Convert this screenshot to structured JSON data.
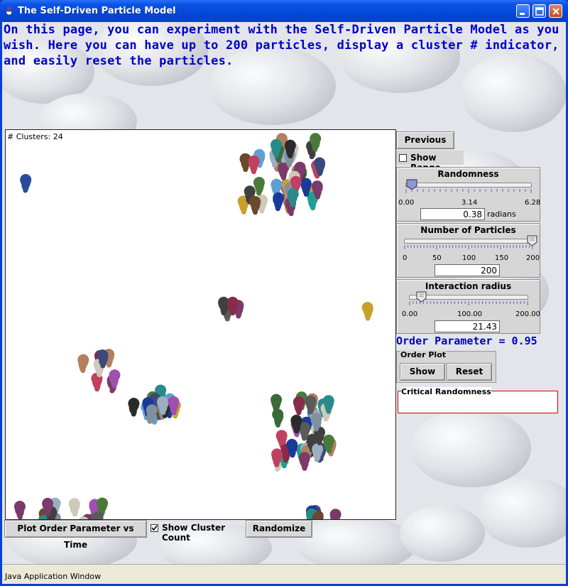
{
  "window": {
    "title": "The Self-Driven Particle Model"
  },
  "intro_text": "On this page, you can experiment with the Self-Driven Particle Model as you wish. Here you can have up to 200 particles, display a cluster # indicator, and easily reset the particles.",
  "simulation": {
    "cluster_label": "# Clusters: 24"
  },
  "buttons": {
    "previous": "Previous",
    "plot_order": "Plot Order Parameter vs Time",
    "randomize": "Randomize",
    "show": "Show",
    "reset": "Reset"
  },
  "checkboxes": {
    "show_range": {
      "label": "Show Range",
      "checked": false
    },
    "show_cluster_count": {
      "label": "Show Cluster Count",
      "checked": true
    }
  },
  "sliders": {
    "randomness": {
      "title": "Randomness",
      "ticks": [
        "0.00",
        "3.14",
        "6.28"
      ],
      "value": "0.38",
      "unit": "radians",
      "min": 0,
      "max": 6.28
    },
    "particles": {
      "title": "Number of Particles",
      "ticks": [
        "0",
        "50",
        "100",
        "150",
        "200"
      ],
      "value": "200",
      "min": 0,
      "max": 200
    },
    "radius": {
      "title": "Interaction radius",
      "ticks": [
        "0.00",
        "100.00",
        "200.00"
      ],
      "value": "21.43",
      "min": 0,
      "max": 200
    }
  },
  "order_parameter": "Order Parameter = 0.95",
  "order_plot_label": "Order Plot",
  "critical_label": "Critical Randomness",
  "status_bar": "Java Application Window",
  "colors": {
    "title_blue": "#0a54e6",
    "intro_text": "#0000cc",
    "critical_border": "#cc0000"
  }
}
